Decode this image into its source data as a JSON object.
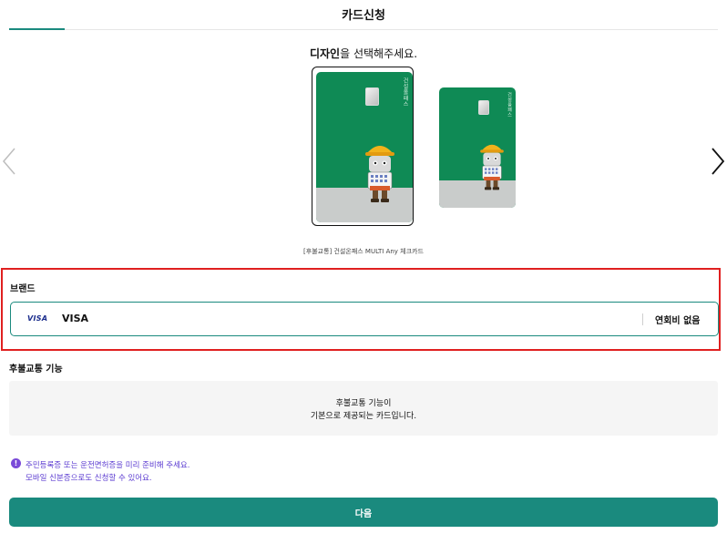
{
  "header": {
    "title": "카드신청"
  },
  "design": {
    "title_bold": "디자인",
    "title_rest": "을 선택해주세요.",
    "card_name": "[후불교통] 건설온패스 MULTI Any 체크카드",
    "card_vertical_text": "건설올패스"
  },
  "brand": {
    "label": "브랜드",
    "option": {
      "logo": "VISA",
      "name": "VISA",
      "fee": "연회비 없음"
    }
  },
  "deferred": {
    "label": "후불교통 기능",
    "line1": "후불교통 기능이",
    "line2": "기본으로 제공되는 카드입니다."
  },
  "notice": {
    "icon": "!",
    "line1": "주민등록증 또는 운전면허증을 미리 준비해 주세요.",
    "line2": "모바일 신분증으로도 신청할 수 있어요."
  },
  "buttons": {
    "next": "다음"
  },
  "colors": {
    "accent": "#1a8a7e",
    "card_green": "#0f8a55",
    "highlight": "#e02020",
    "notice": "#5b3bd1"
  }
}
